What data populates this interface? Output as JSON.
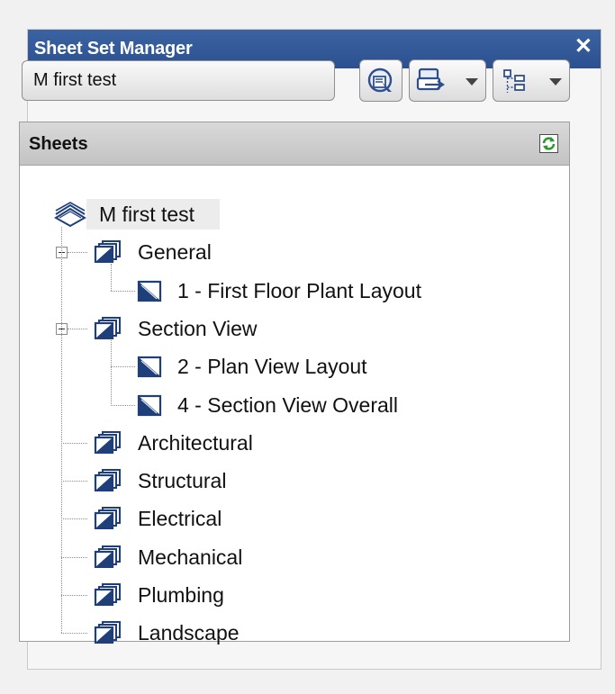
{
  "window": {
    "title": "Sheet Set Manager",
    "close_glyph": "✕"
  },
  "toolbar": {
    "sheet_set_name": "M first test",
    "buttons": [
      "publish-icon",
      "transmit-icon",
      "view-options-icon"
    ]
  },
  "tree": {
    "header_label": "Sheets",
    "root": {
      "label": "M first test",
      "icon": "sheet-set-icon"
    },
    "subsets": [
      {
        "label": "General",
        "expanded": true,
        "sheets": [
          "1 - First Floor Plant Layout"
        ]
      },
      {
        "label": "Section View",
        "expanded": true,
        "sheets": [
          "2 - Plan View Layout",
          "4 - Section View Overall"
        ]
      },
      {
        "label": "Architectural"
      },
      {
        "label": "Structural"
      },
      {
        "label": "Electrical"
      },
      {
        "label": "Mechanical"
      },
      {
        "label": "Plumbing"
      },
      {
        "label": "Landscape"
      }
    ]
  },
  "colors": {
    "titlebar": "#2c5090",
    "icon_blue": "#1f3f7a",
    "refresh_green": "#2a9a2a"
  }
}
